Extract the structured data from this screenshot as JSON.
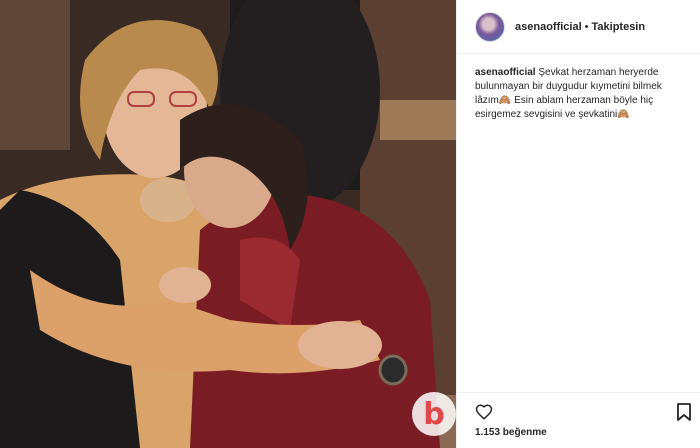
{
  "post": {
    "username": "asenaofficial",
    "separator": "•",
    "follow_label": "Takiptesin",
    "caption_user": "asenaofficial",
    "caption_text": "Şevkat herzaman heryerde bulunmayan bir duygudur kıymetini bilmek lâzım",
    "caption_text_2": "Esin ablam herzaman böyle hiç esirgemez sevgisini ve şevkatini",
    "likes": "1.153 beğenme",
    "watermark": "b"
  },
  "icons": {
    "emoji": "see-no-evil-monkey-icon",
    "like": "heart-icon",
    "save": "bookmark-icon"
  },
  "colors": {
    "text": "#262626",
    "border": "#efefef",
    "watermark": "#e0484a"
  }
}
